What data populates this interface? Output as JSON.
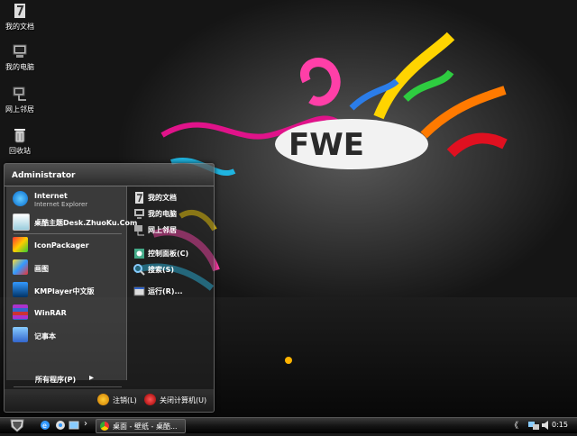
{
  "desktop": {
    "icons": [
      {
        "label": "我的文档",
        "icon": "my-documents-icon"
      },
      {
        "label": "我的电脑",
        "icon": "my-computer-icon"
      },
      {
        "label": "网上邻居",
        "icon": "network-places-icon"
      },
      {
        "label": "回收站",
        "icon": "recycle-bin-icon"
      }
    ]
  },
  "start_menu": {
    "user": "Administrator",
    "pinned": [
      {
        "name": "Internet",
        "sub": "Internet Explorer",
        "icon": "internet-explorer-icon"
      },
      {
        "name": "桌酷主题Desk.ZhuoKu.Com",
        "icon": "zhuoku-theme-icon"
      },
      {
        "name": "IconPackager",
        "icon": "iconpackager-icon"
      },
      {
        "name": "画图",
        "icon": "paint-icon"
      },
      {
        "name": "KMPlayer中文版",
        "icon": "kmplayer-icon"
      },
      {
        "name": "WinRAR",
        "icon": "winrar-icon"
      },
      {
        "name": "记事本",
        "icon": "notepad-icon"
      }
    ],
    "all_programs": "所有程序(P)",
    "right": [
      {
        "name": "我的文档",
        "icon": "my-documents-icon"
      },
      {
        "name": "我的电脑",
        "icon": "my-computer-icon"
      },
      {
        "name": "网上邻居",
        "icon": "network-places-icon"
      },
      {
        "name": "控制面板(C)",
        "icon": "control-panel-icon"
      },
      {
        "name": "搜索(S)",
        "icon": "search-icon"
      },
      {
        "name": "运行(R)...",
        "icon": "run-icon"
      }
    ],
    "logoff": "注销(L)",
    "shutdown": "关闭计算机(U)"
  },
  "taskbar": {
    "task_label": "桌面 - 壁纸 - 桌酷...",
    "clock": "0:15",
    "chevron": "›",
    "tray_arrow": "《"
  },
  "colors": {
    "accent": "#d81d8c",
    "taskbar": "#151515"
  }
}
